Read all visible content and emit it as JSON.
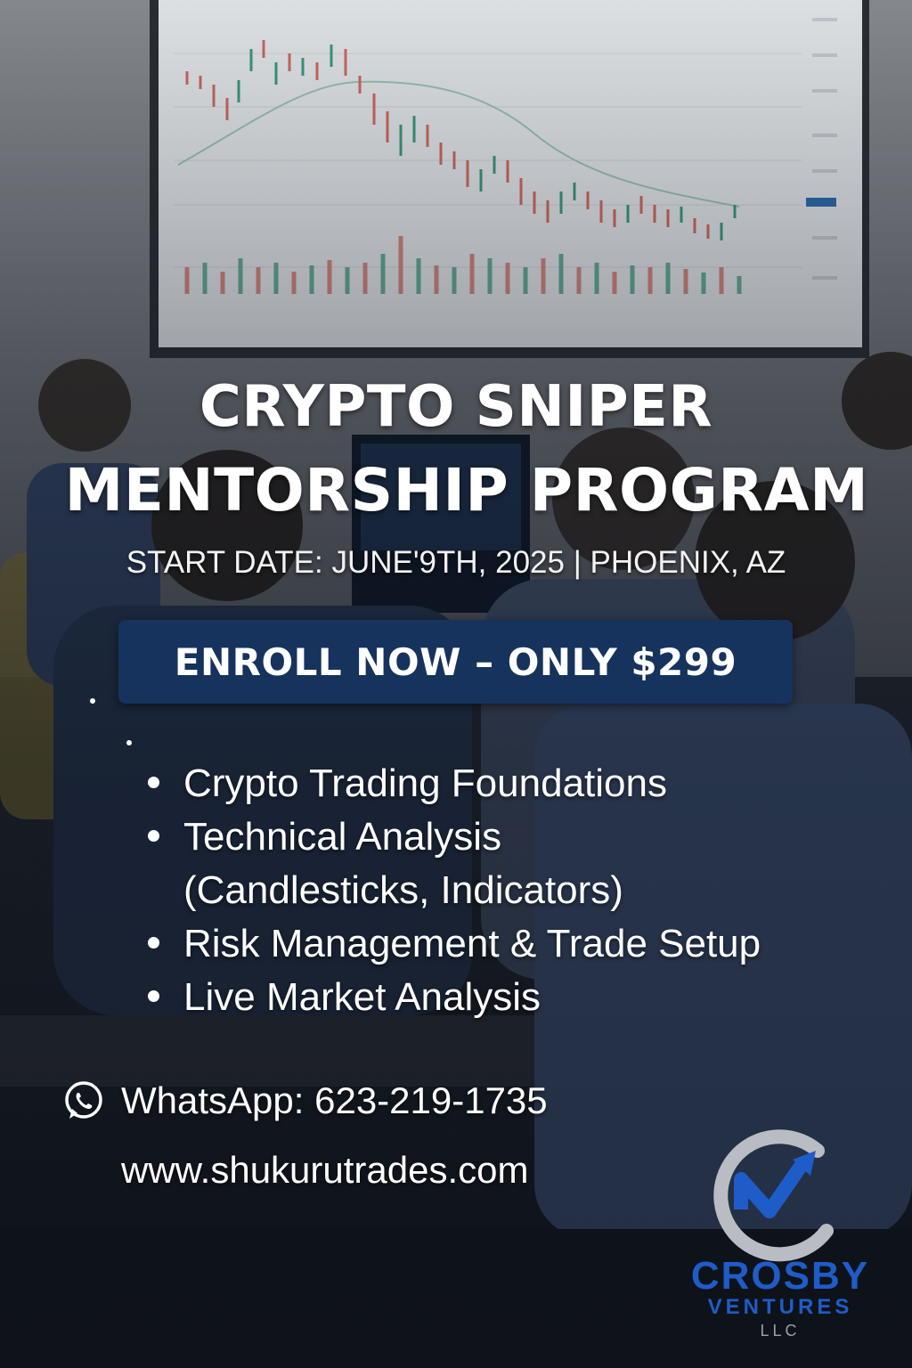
{
  "poster": {
    "title_line1": "CRYPTO SNIPER",
    "title_line2": "MENTORSHIP PROGRAM",
    "start_line": "START DATE: JUNE'9TH, 2025 | PHOENIX, AZ",
    "enroll_label": "ENROLL NOW – ONLY $299",
    "curriculum": [
      "Crypto Trading Foundations",
      "Technical Analysis",
      "(Candlesticks, Indicators)",
      "Risk Management & Trade Setup",
      "Live Market Analysis"
    ],
    "whatsapp_label": "WhatsApp: 623-219-1735",
    "website": "www.shukurutrades.com"
  },
  "logo": {
    "name": "CROSBY",
    "sub": "VENTURES",
    "suffix": "LLC"
  },
  "icons": {
    "contact": "whatsapp-icon",
    "logo": "crosby-ventures-logo"
  },
  "colors": {
    "button_bg": "#16335d",
    "brand_blue": "#1e5cc9",
    "text": "#ffffff"
  }
}
